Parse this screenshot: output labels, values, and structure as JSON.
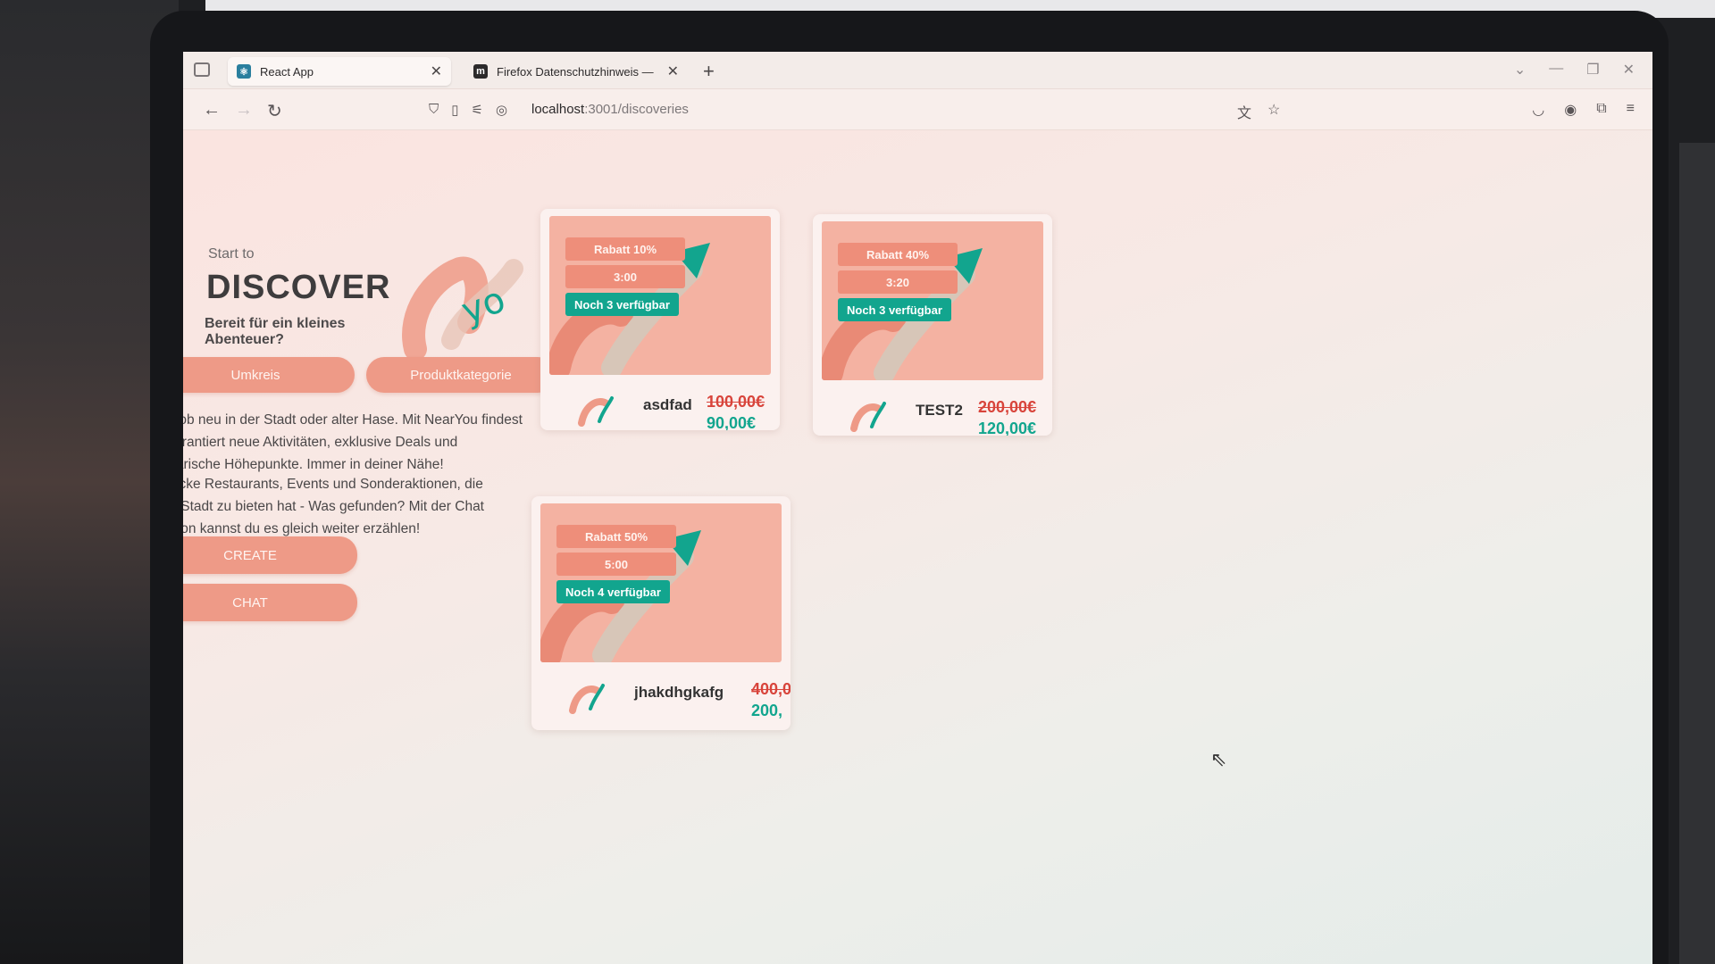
{
  "browser": {
    "tabs": [
      {
        "label": "React App",
        "active": true,
        "favicon": "react-favicon"
      },
      {
        "label": "Firefox Datenschutzhinweis —",
        "active": false,
        "favicon": "m"
      }
    ],
    "url_host": "localhost",
    "url_rest": ":3001/discoveries"
  },
  "hero": {
    "start_to": "Start to",
    "title": "DISCOVER",
    "subtitle": "Bereit für ein kleines Abenteuer?"
  },
  "filters": {
    "umkreis": "Umkreis",
    "produktkategorie": "Produktkategorie"
  },
  "paragraphs": [
    "Egal ob neu in der Stadt oder alter Hase. Mit NearYou findest du garantiert neue Aktivitäten, exklusive Deals und kulinarische Höhepunkte. Immer in deiner Nähe!",
    "Entdecke Restaurants, Events und Sonderaktionen, die deine Stadt zu bieten hat - Was gefunden? Mit der Chat Funktion kannst du es gleich weiter erzählen!"
  ],
  "actions": {
    "create": "CREATE",
    "chat": "CHAT"
  },
  "cards": [
    {
      "rabatt": "Rabatt 10%",
      "time": "3:00",
      "available": "Noch 3 verfügbar",
      "name": "asdfad",
      "price_old": "100,00€",
      "price_new": "90,00€"
    },
    {
      "rabatt": "Rabatt 40%",
      "time": "3:20",
      "available": "Noch 3 verfügbar",
      "name": "TEST2",
      "price_old": "200,00€",
      "price_new": "120,00€"
    },
    {
      "rabatt": "Rabatt 50%",
      "time": "5:00",
      "available": "Noch 4 verfügbar",
      "name": "jhakdhgkafg",
      "price_old": "400,0",
      "price_new": "200,"
    }
  ],
  "colors": {
    "accent": "#ee9a87",
    "teal": "#12a58e",
    "price_red": "#d8443b"
  }
}
